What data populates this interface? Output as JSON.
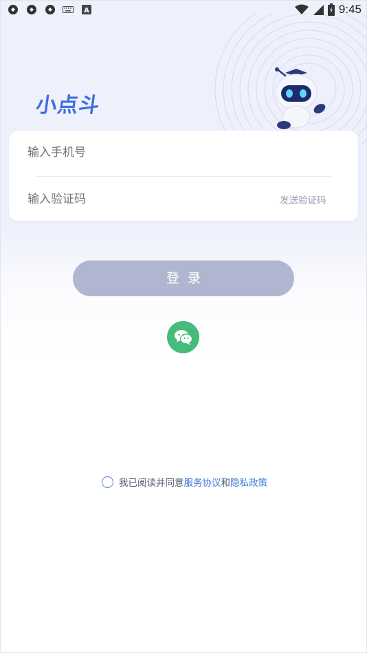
{
  "status_bar": {
    "time": "9:45",
    "icons": [
      "sync-icon",
      "sync-icon",
      "sync-icon",
      "keyboard-icon",
      "a-icon"
    ],
    "right_icons": [
      "wifi-icon",
      "signal-icon",
      "battery-icon"
    ]
  },
  "app": {
    "logo_text": "小点斗"
  },
  "form": {
    "phone_placeholder": "输入手机号",
    "code_placeholder": "输入验证码",
    "send_code_label": "发送验证码"
  },
  "login_button_label": "登录",
  "wechat_login_icon": "wechat-icon",
  "agreement": {
    "prefix": "我已阅读并同意",
    "service_link": "服务协议",
    "conjunction": "和",
    "privacy_link": "隐私政策"
  },
  "colors": {
    "accent": "#3f78d8",
    "login_button": "#b0b6cf",
    "wechat_green": "#46bb7b",
    "background_top": "#eef0fb"
  }
}
